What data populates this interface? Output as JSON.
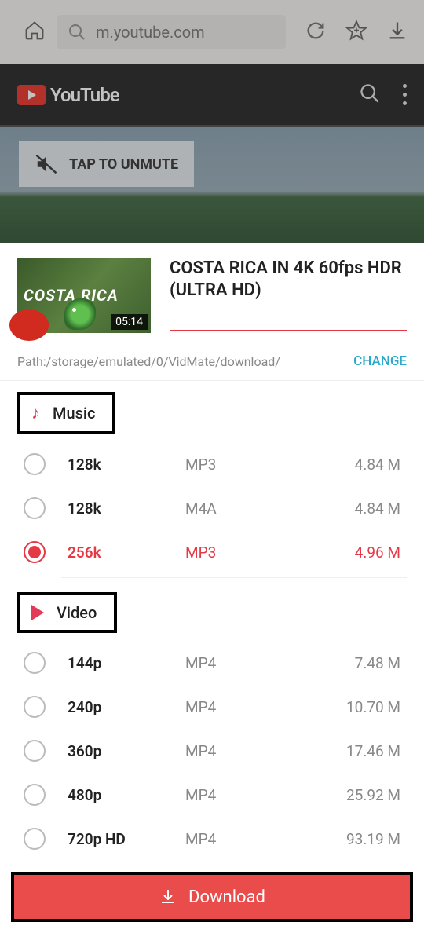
{
  "browser": {
    "url": "m.youtube.com"
  },
  "youtube": {
    "brand": "YouTube",
    "unmute_label": "TAP TO UNMUTE"
  },
  "video": {
    "thumb_text": "COSTA RICA",
    "duration": "05:14",
    "title": "COSTA RICA IN 4K 60fps HDR (ULTRA HD)"
  },
  "path": {
    "value": "Path:/storage/emulated/0/VidMate/download/",
    "change_label": "CHANGE"
  },
  "sections": {
    "music": "Music",
    "video": "Video"
  },
  "music_options": [
    {
      "quality": "128k",
      "format": "MP3",
      "size": "4.84 M",
      "selected": false
    },
    {
      "quality": "128k",
      "format": "M4A",
      "size": "4.84 M",
      "selected": false
    },
    {
      "quality": "256k",
      "format": "MP3",
      "size": "4.96 M",
      "selected": true
    }
  ],
  "video_options": [
    {
      "quality": "144p",
      "format": "MP4",
      "size": "7.48 M"
    },
    {
      "quality": "240p",
      "format": "MP4",
      "size": "10.70 M"
    },
    {
      "quality": "360p",
      "format": "MP4",
      "size": "17.46 M"
    },
    {
      "quality": "480p",
      "format": "MP4",
      "size": "25.92 M"
    },
    {
      "quality": "720p HD",
      "format": "MP4",
      "size": "93.19 M"
    }
  ],
  "download_label": "Download"
}
